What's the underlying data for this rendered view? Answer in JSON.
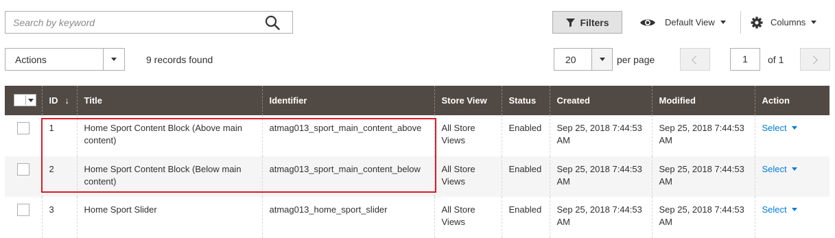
{
  "search": {
    "placeholder": "Search by keyword"
  },
  "toolbar": {
    "filters_label": "Filters",
    "view_label": "Default View",
    "columns_label": "Columns",
    "actions_label": "Actions",
    "records_found": "9 records found",
    "per_page_value": "20",
    "per_page_label": "per page",
    "current_page": "1",
    "of_pages": "of 1"
  },
  "table": {
    "headers": {
      "id": "ID",
      "sort_indicator": "↓",
      "title": "Title",
      "identifier": "Identifier",
      "store_view": "Store View",
      "status": "Status",
      "created": "Created",
      "modified": "Modified",
      "action": "Action"
    },
    "rows": [
      {
        "id": "1",
        "title": "Home Sport Content Block (Above main content)",
        "identifier": "atmag013_sport_main_content_above",
        "store_view": "All Store Views",
        "status": "Enabled",
        "created": "Sep 25, 2018 7:44:53 AM",
        "modified": "Sep 25, 2018 7:44:53 AM",
        "action": "Select"
      },
      {
        "id": "2",
        "title": "Home Sport Content Block (Below main content)",
        "identifier": "atmag013_sport_main_content_below",
        "store_view": "All Store Views",
        "status": "Enabled",
        "created": "Sep 25, 2018 7:44:53 AM",
        "modified": "Sep 25, 2018 7:44:53 AM",
        "action": "Select"
      },
      {
        "id": "3",
        "title": "Home Sport Slider",
        "identifier": "atmag013_home_sport_slider",
        "store_view": "All Store Views",
        "status": "Enabled",
        "created": "Sep 25, 2018 7:44:53 AM",
        "modified": "Sep 25, 2018 7:44:53 AM",
        "action": "Select"
      }
    ]
  },
  "colors": {
    "header_bg": "#514943",
    "link": "#007bdb",
    "highlight_border": "#d81b2b",
    "alt_row": "#f5f5f5"
  },
  "icons": [
    "search-icon",
    "filter-icon",
    "eye-icon",
    "gear-icon",
    "chevron-left-icon",
    "chevron-right-icon"
  ]
}
